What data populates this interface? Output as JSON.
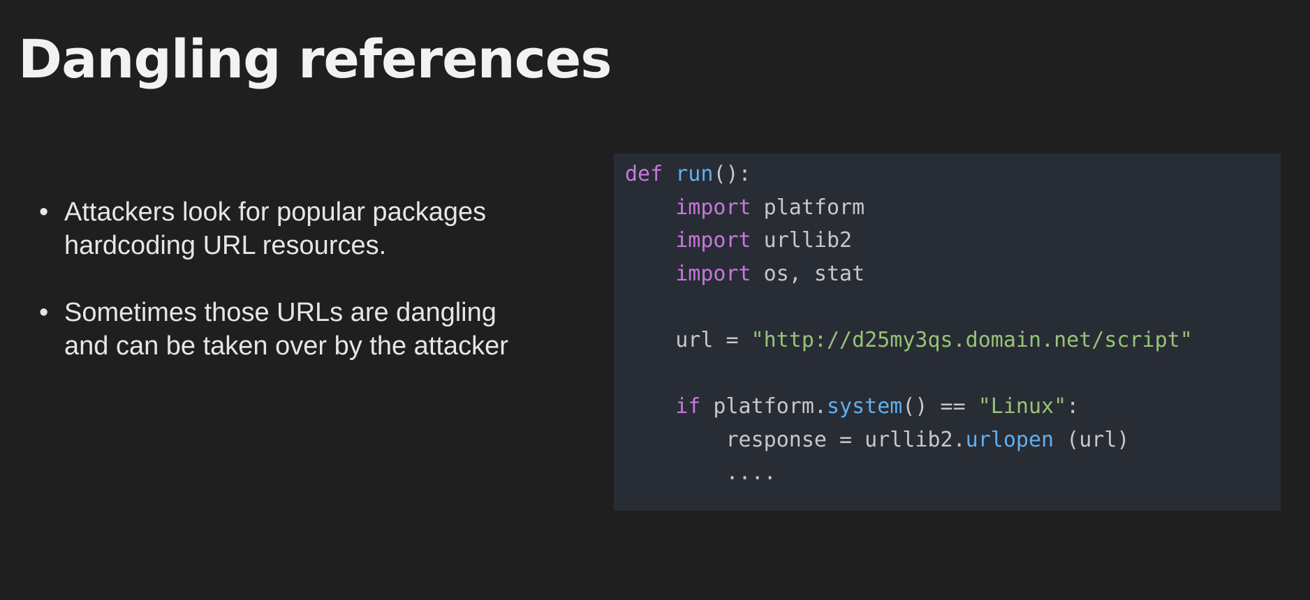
{
  "slide": {
    "title": "Dangling references",
    "bullets": [
      {
        "line1": "Attackers look for popular packages",
        "line2": "hardcoding URL resources."
      },
      {
        "line1": "Sometimes those URLs are dangling",
        "line2": "and can be taken over by the attacker"
      }
    ],
    "bullet_glyph": "•"
  },
  "code": {
    "lines": [
      [
        {
          "t": "def",
          "c": "kw"
        },
        {
          "t": " "
        },
        {
          "t": "run",
          "c": "fn"
        },
        {
          "t": "():"
        }
      ],
      [
        {
          "t": "    "
        },
        {
          "t": "import",
          "c": "kw"
        },
        {
          "t": " platform"
        }
      ],
      [
        {
          "t": "    "
        },
        {
          "t": "import",
          "c": "kw"
        },
        {
          "t": " urllib2"
        }
      ],
      [
        {
          "t": "    "
        },
        {
          "t": "import",
          "c": "kw"
        },
        {
          "t": " os, stat"
        }
      ],
      [
        {
          "t": ""
        }
      ],
      [
        {
          "t": "    url = "
        },
        {
          "t": "\"http://d25my3qs.domain.net/script\"",
          "c": "str"
        }
      ],
      [
        {
          "t": ""
        }
      ],
      [
        {
          "t": "    "
        },
        {
          "t": "if",
          "c": "kw"
        },
        {
          "t": " platform."
        },
        {
          "t": "system",
          "c": "fn"
        },
        {
          "t": "() == "
        },
        {
          "t": "\"Linux\"",
          "c": "str"
        },
        {
          "t": ":"
        }
      ],
      [
        {
          "t": "        response = urllib2."
        },
        {
          "t": "urlopen",
          "c": "fn"
        },
        {
          "t": " (url)"
        }
      ],
      [
        {
          "t": "        ...."
        }
      ]
    ],
    "colors": {
      "background": "#282c34",
      "keyword": "#c678dd",
      "function": "#61afef",
      "string": "#98c379",
      "text": "#c5c8ce"
    }
  }
}
